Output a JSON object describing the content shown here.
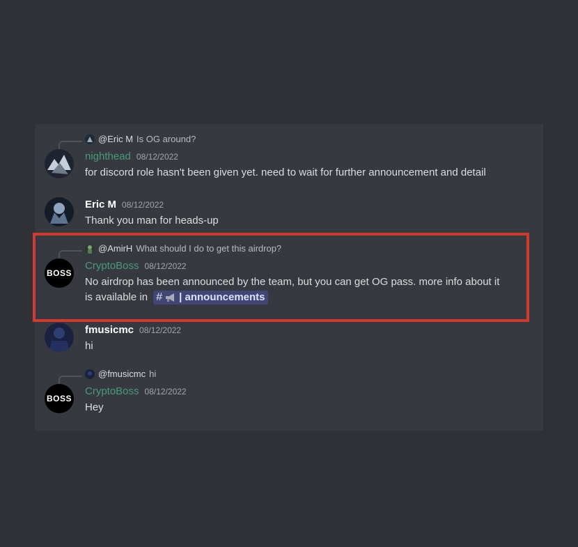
{
  "messages": [
    {
      "reply": {
        "mention": "@Eric M",
        "text": "Is OG around?"
      },
      "username": "nighthead",
      "timestamp": "08/12/2022",
      "content": "for discord role hasn't been given yet. need to wait for further announcement and detail"
    },
    {
      "username": "Eric M",
      "timestamp": "08/12/2022",
      "content": "Thank you man for heads-up"
    },
    {
      "reply": {
        "mention": "@AmirH",
        "text": "What should I do to get this airdrop?"
      },
      "username": "CryptoBoss",
      "timestamp": "08/12/2022",
      "content": "No airdrop has been announced by the team, but you can get OG pass. more info about it is available in",
      "channel": {
        "hash": "#",
        "label": "| announcements",
        "icon": "megaphone-icon"
      },
      "avatar_text": "BOSS"
    },
    {
      "username": "fmusicmc",
      "timestamp": "08/12/2022",
      "content": "hi"
    },
    {
      "reply": {
        "mention": "@fmusicmc",
        "text": "hi"
      },
      "username": "CryptoBoss",
      "timestamp": "08/12/2022",
      "content": "Hey",
      "avatar_text": "BOSS"
    }
  ],
  "colors": {
    "background": "#2f3136",
    "panel": "#36393f",
    "highlight": "#d33a2f",
    "green_name": "#4a9a78",
    "mention_bg": "#414675"
  }
}
